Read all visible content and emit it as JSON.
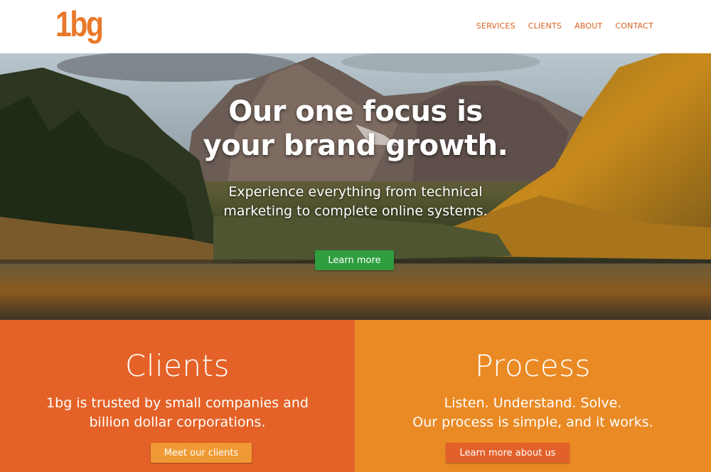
{
  "brand": {
    "logo": "1bg",
    "logo_color": "#e8792a"
  },
  "nav": {
    "items": [
      "SERVICES",
      "CLIENTS",
      "ABOUT",
      "CONTACT"
    ],
    "color": "#d9611f"
  },
  "hero": {
    "title_line1": "Our one focus is",
    "title_line2": "your brand growth.",
    "subtitle_line1": "Experience everything from technical",
    "subtitle_line2": "marketing to complete online systems.",
    "button_label": "Learn more",
    "button_color": "#2e9e3e"
  },
  "panels": {
    "clients": {
      "title": "Clients",
      "text_line1": "1bg is trusted by small companies and",
      "text_line2": "billion dollar corporations.",
      "button_label": "Meet our clients",
      "background": "#e46227"
    },
    "process": {
      "title": "Process",
      "text_line1": "Listen. Understand. Solve.",
      "text_line2": "Our process is simple, and it works.",
      "button_label": "Learn more about us",
      "background": "#ea8a24"
    }
  }
}
